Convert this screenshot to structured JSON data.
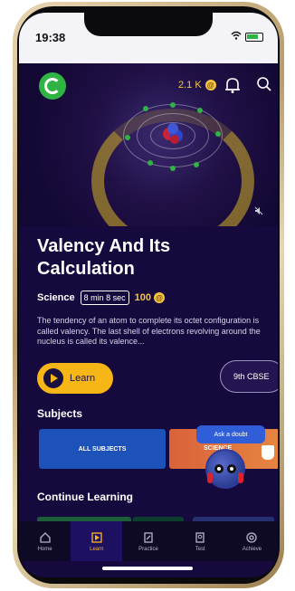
{
  "status": {
    "time": "19:38"
  },
  "header": {
    "coins": "2.1 K"
  },
  "lesson": {
    "title": "Valency And Its Calculation",
    "subject": "Science",
    "duration": "8 min 8 sec",
    "points": "100",
    "description": "The tendency of an atom to complete its octet configuration is called valency. The last shell of electrons revolving around the nucleus is called its valence...",
    "learn_label": "Learn",
    "grade_label": "9th CBSE"
  },
  "subjects": {
    "heading": "Subjects",
    "all_label": "ALL SUBJECTS",
    "science_label": "SCIENCE",
    "ask_doubt": "Ask a doubt"
  },
  "continue": {
    "heading": "Continue Learning"
  },
  "nav": {
    "items": [
      {
        "label": "Home",
        "icon": "home-icon"
      },
      {
        "label": "Learn",
        "icon": "learn-icon"
      },
      {
        "label": "Practice",
        "icon": "practice-icon"
      },
      {
        "label": "Test",
        "icon": "test-icon"
      },
      {
        "label": "Achieve",
        "icon": "achieve-icon"
      }
    ]
  },
  "colors": {
    "accent": "#f6b615",
    "background": "#15093d",
    "brand_green": "#2fb345"
  }
}
